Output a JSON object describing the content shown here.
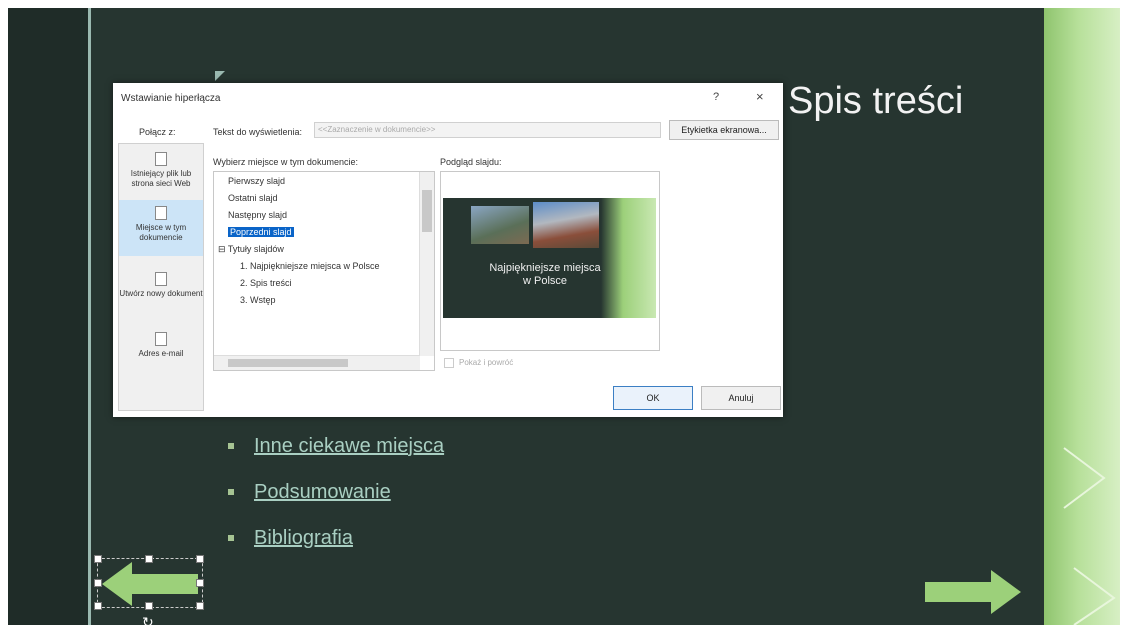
{
  "slide": {
    "title": "Spis treści",
    "bullets": [
      "Inne ciekawe miejsca",
      "Podsumowanie",
      "Bibliografia"
    ]
  },
  "dialog": {
    "title": "Wstawianie hiperłącza",
    "help": "?",
    "close": "×",
    "link_to_label": "Połącz z:",
    "link_to_items": [
      "Istniejący plik lub strona sieci Web",
      "Miejsce w tym dokumencie",
      "Utwórz nowy dokument",
      "Adres e-mail"
    ],
    "display_text_label": "Tekst do wyświetlenia:",
    "display_text_value": "<<Zaznaczenie w dokumencie>>",
    "screentip_button": "Etykietka ekranowa...",
    "place_label": "Wybierz miejsce w tym dokumencie:",
    "tree": [
      "Pierwszy slajd",
      "Ostatni slajd",
      "Następny slajd",
      "Poprzedni slajd",
      "Tytuły slajdów",
      "1. Najpiękniejsze miejsca w Polsce",
      "2. Spis treści",
      "3. Wstęp"
    ],
    "preview_label": "Podgląd slajdu:",
    "preview_slide_title": "Najpiękniejsze miejsca w Polsce",
    "show_and_return": "Pokaż i powróć",
    "ok": "OK",
    "cancel": "Anuluj"
  },
  "colors": {
    "slide_bg": "#263530",
    "accent_green": "#9cd07a",
    "link": "#a9cfc2",
    "selection": "#0a64c8"
  }
}
